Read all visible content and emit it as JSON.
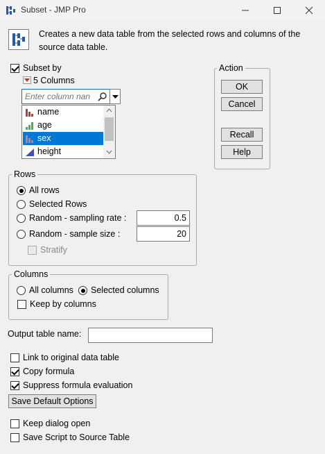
{
  "window": {
    "title": "Subset - JMP Pro"
  },
  "description": "Creates a new data table from the selected rows and columns of the source data table.",
  "subset": {
    "label": "Subset by",
    "checked": true,
    "columns_count": "5 Columns",
    "search_placeholder": "Enter column nan",
    "columns": [
      {
        "name": "name",
        "type": "nominal"
      },
      {
        "name": "age",
        "type": "ordinal"
      },
      {
        "name": "sex",
        "type": "nominal",
        "selected": true
      },
      {
        "name": "height",
        "type": "continuous"
      }
    ]
  },
  "action": {
    "title": "Action",
    "ok": "OK",
    "cancel": "Cancel",
    "recall": "Recall",
    "help": "Help"
  },
  "rows": {
    "title": "Rows",
    "all_rows": "All rows",
    "selected_rows": "Selected Rows",
    "random_rate": "Random - sampling rate :",
    "random_rate_value": "0.5",
    "random_size": "Random - sample size :",
    "random_size_value": "20",
    "stratify": "Stratify"
  },
  "columns": {
    "title": "Columns",
    "all_columns": "All columns",
    "selected_columns": "Selected columns",
    "keep_by_columns": "Keep by columns"
  },
  "output": {
    "label": "Output table name:",
    "value": ""
  },
  "options": {
    "link_original": "Link to original data table",
    "copy_formula": "Copy formula",
    "suppress_formula": "Suppress formula evaluation",
    "save_default": "Save Default Options",
    "keep_dialog_open": "Keep dialog open",
    "save_script": "Save Script to Source Table"
  },
  "colors": {
    "selection": "#0078d7",
    "nominal_icon": "#c0392b",
    "ordinal_icon": "#4caf50",
    "continuous_icon": "#3f51b5"
  }
}
